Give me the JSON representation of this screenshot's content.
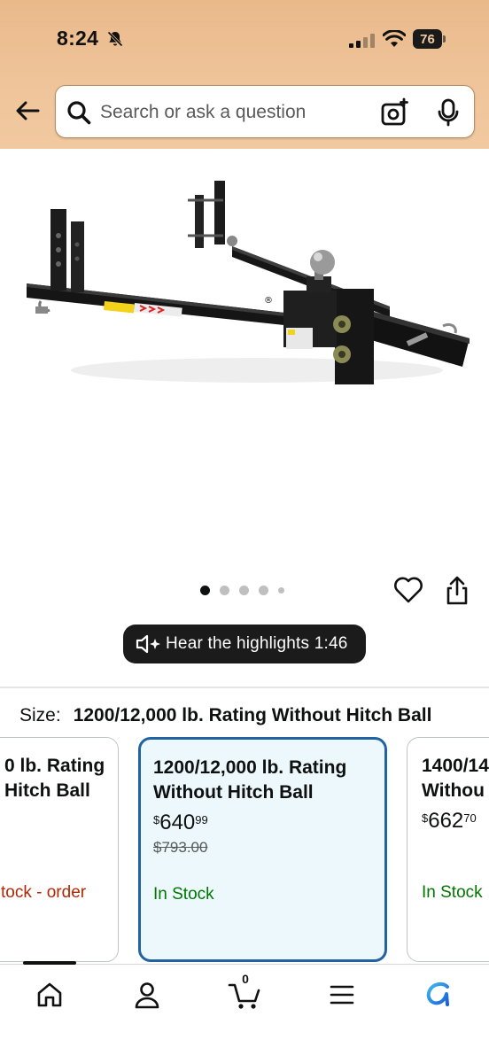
{
  "status_bar": {
    "time": "8:24",
    "battery": "76"
  },
  "search": {
    "placeholder": "Search or ask a question"
  },
  "carousel": {
    "total_dots": 5,
    "active_index": 0
  },
  "audio": {
    "label": "Hear the highlights 1:46"
  },
  "size": {
    "label": "Size:",
    "selected": "1200/12,000 lb. Rating Without Hitch Ball",
    "options": [
      {
        "title_line1": "0 lb. Rating",
        "title_line2": "Hitch Ball",
        "stock": "tock - order",
        "stock_color": "#b12704"
      },
      {
        "title_line1": "1200/12,000 lb. Rating",
        "title_line2": "Without Hitch Ball",
        "price_currency": "$",
        "price_whole": "640",
        "price_fraction": "99",
        "list_price": "$793.00",
        "stock": "In Stock",
        "stock_color": "#007600"
      },
      {
        "title_line1": "1400/14",
        "title_line2": "Withou",
        "price_currency": "$",
        "price_whole": "662",
        "price_fraction": "70",
        "stock": "In Stock",
        "stock_color": "#007600"
      }
    ]
  },
  "bottom_nav": {
    "items": [
      "home-icon",
      "account-icon",
      "cart-icon",
      "menu-icon",
      "rufus-icon"
    ],
    "cart_count": "0"
  },
  "colors": {
    "header_bg": "#efc49a",
    "selected_border": "#2162a1",
    "selected_bg": "#edf8fd",
    "in_stock": "#007600",
    "out_of_stock": "#b12704"
  }
}
